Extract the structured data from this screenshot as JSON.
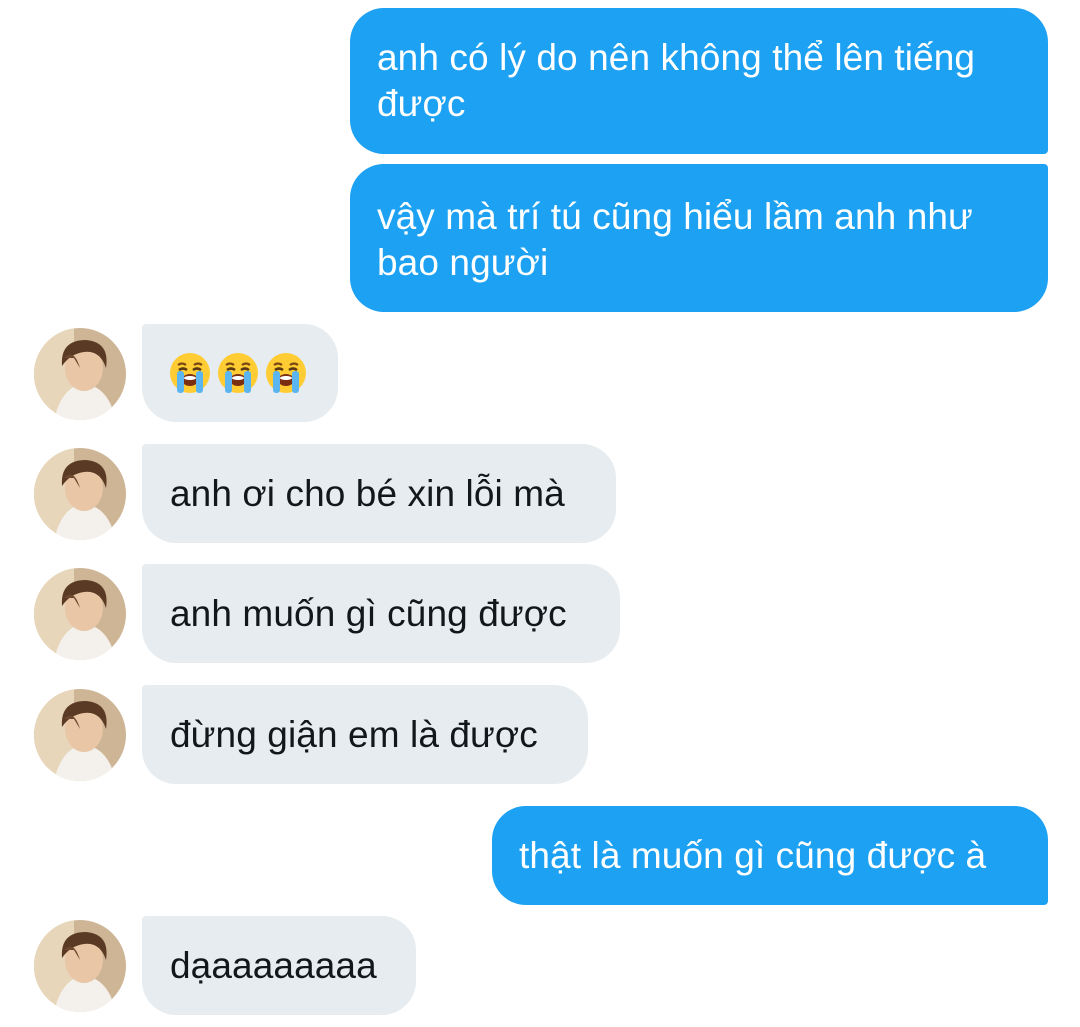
{
  "colors": {
    "sent_bubble": "#1da1f2",
    "received_bubble": "#e6ecf0",
    "sent_text": "#ffffff",
    "received_text": "#14171a"
  },
  "messages": [
    {
      "direction": "sent",
      "lines": [
        "anh có lý do nên không thể lên tiếng",
        "được"
      ]
    },
    {
      "direction": "sent",
      "lines": [
        "vậy mà trí tú cũng hiểu lầm anh như",
        "bao người"
      ]
    },
    {
      "direction": "received",
      "emoji": [
        "loudly-crying-face",
        "loudly-crying-face",
        "loudly-crying-face"
      ],
      "avatar": "contact-avatar"
    },
    {
      "direction": "received",
      "text": "anh ơi cho bé xin lỗi mà",
      "avatar": "contact-avatar"
    },
    {
      "direction": "received",
      "text": "anh muốn gì cũng được",
      "avatar": "contact-avatar"
    },
    {
      "direction": "received",
      "text": "đừng giận em là được",
      "avatar": "contact-avatar"
    },
    {
      "direction": "sent",
      "text": "thật là muốn gì cũng được à"
    },
    {
      "direction": "received",
      "text": "dạaaaaaaaa",
      "avatar": "contact-avatar"
    }
  ]
}
